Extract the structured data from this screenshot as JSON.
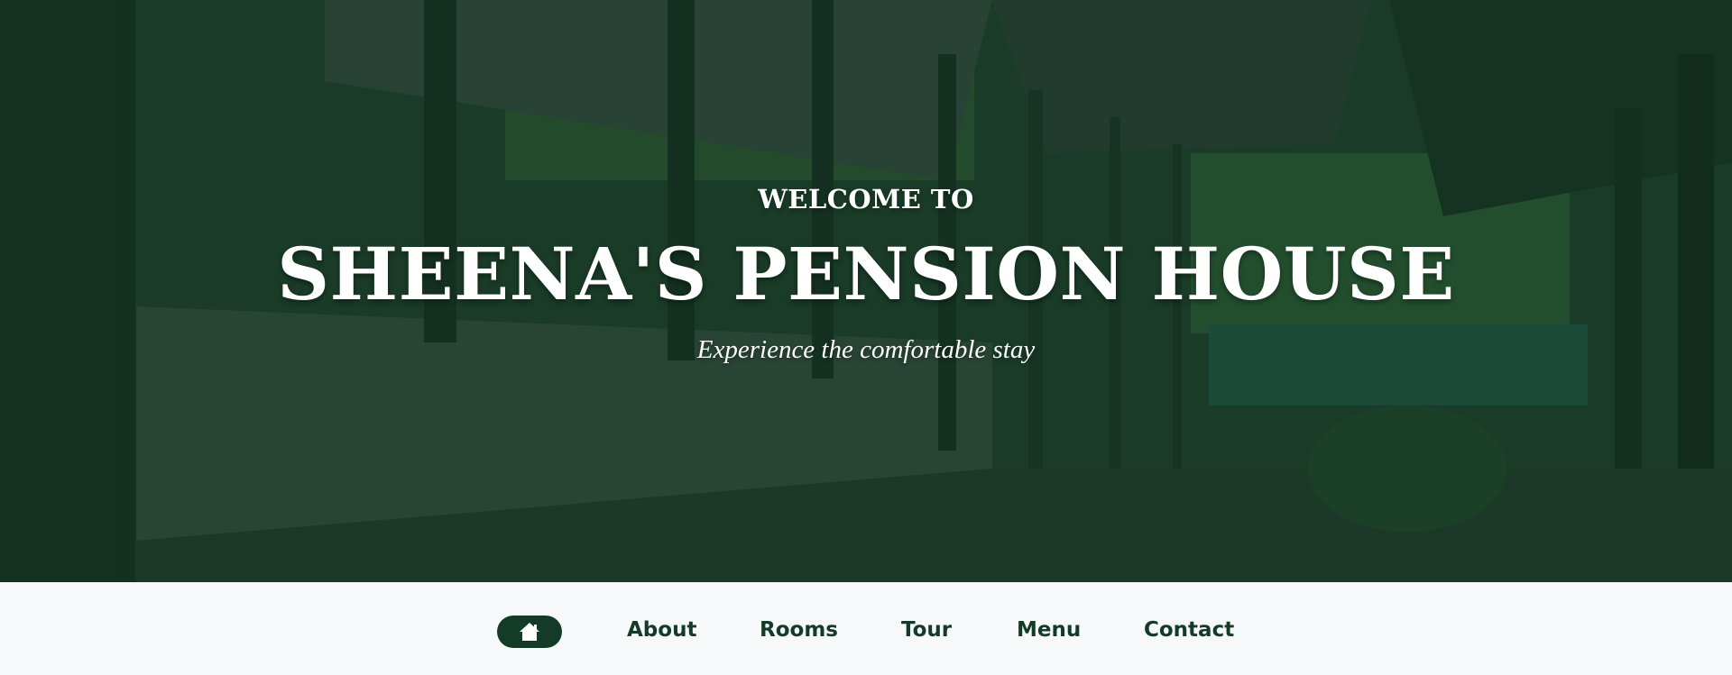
{
  "hero": {
    "welcome": "WELCOME TO",
    "title": "SHEENA'S PENSION HOUSE",
    "tagline": "Experience the comfortable stay"
  },
  "nav": {
    "home_icon": "home-icon",
    "items": [
      {
        "label": "About"
      },
      {
        "label": "Rooms"
      },
      {
        "label": "Tour"
      },
      {
        "label": "Menu"
      },
      {
        "label": "Contact"
      }
    ]
  },
  "colors": {
    "brand_green": "#143b28",
    "nav_background": "#f7f8f9",
    "hero_text": "#ffffff"
  }
}
